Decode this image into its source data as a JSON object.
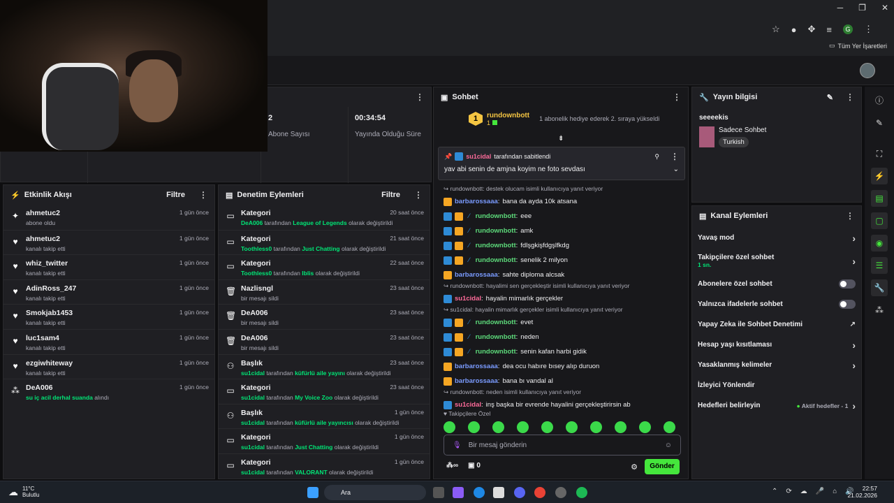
{
  "browser": {
    "bookmarks_label": "Tüm Yer İşaretleri",
    "profile_initial": "G"
  },
  "stats": [
    {
      "value": "2",
      "label": "Abone Sayısı"
    },
    {
      "value": "00:34:54",
      "label": "Yayında Olduğu Süre"
    }
  ],
  "feed": {
    "title": "Etkinlik Akışı",
    "filter": "Filtre",
    "items": [
      {
        "user": "ahmetuc2",
        "action": "abone oldu",
        "time": "1 gün önce",
        "icon": "sparkle"
      },
      {
        "user": "ahmetuc2",
        "action": "kanalı takip etti",
        "time": "1 gün önce",
        "icon": "heart"
      },
      {
        "user": "whiz_twitter",
        "action": "kanalı takip etti",
        "time": "1 gün önce",
        "icon": "heart"
      },
      {
        "user": "AdinRoss_247",
        "action": "kanalı takip etti",
        "time": "1 gün önce",
        "icon": "heart"
      },
      {
        "user": "Smokjab1453",
        "action": "kanalı takip etti",
        "time": "1 gün önce",
        "icon": "heart"
      },
      {
        "user": "luc1sam4",
        "action": "kanalı takip etti",
        "time": "1 gün önce",
        "icon": "heart"
      },
      {
        "user": "ezgiwhiteway",
        "action": "kanalı takip etti",
        "time": "1 gün önce",
        "icon": "heart"
      },
      {
        "user": "DeA006",
        "highlight": "su iç acil derhal suanda",
        "action": "alındı",
        "time": "1 gün önce",
        "icon": "points"
      }
    ]
  },
  "audit": {
    "title": "Denetim Eylemleri",
    "filter": "Filtre",
    "items": [
      {
        "title": "Kategori",
        "actor": "DeA006",
        "mid": "tarafından",
        "value": "League of Legends",
        "suffix": "olarak değiştirildi",
        "time": "20 saat önce"
      },
      {
        "title": "Kategori",
        "actor": "Toothless0",
        "mid": "tarafından",
        "value": "Just Chatting",
        "suffix": "olarak değiştirildi",
        "time": "21 saat önce"
      },
      {
        "title": "Kategori",
        "actor": "Toothless0",
        "mid": "tarafından",
        "value": "Iblis",
        "suffix": "olarak değiştirildi",
        "time": "22 saat önce"
      },
      {
        "title": "Nazlisngl",
        "actor": "",
        "mid": "",
        "value": "",
        "suffix": "bir mesajı sildi",
        "time": "23 saat önce"
      },
      {
        "title": "DeA006",
        "actor": "",
        "mid": "",
        "value": "",
        "suffix": "bir mesajı sildi",
        "time": "23 saat önce"
      },
      {
        "title": "DeA006",
        "actor": "",
        "mid": "",
        "value": "",
        "suffix": "bir mesajı sildi",
        "time": "23 saat önce"
      },
      {
        "title": "Başlık",
        "actor": "su1cidal",
        "mid": "tarafından",
        "value": "küfürlü aile yayını",
        "suffix": "olarak değiştirildi",
        "time": "23 saat önce"
      },
      {
        "title": "Kategori",
        "actor": "su1cidal",
        "mid": "tarafından",
        "value": "My Voice Zoo",
        "suffix": "olarak değiştirildi",
        "time": "23 saat önce"
      },
      {
        "title": "Başlık",
        "actor": "su1cidal",
        "mid": "tarafından",
        "value": "küfürlü aile yayıncısı",
        "suffix": "olarak değiştirildi",
        "time": "1 gün önce"
      },
      {
        "title": "Kategori",
        "actor": "su1cidal",
        "mid": "tarafından",
        "value": "Just Chatting",
        "suffix": "olarak değiştirildi",
        "time": "1 gün önce"
      },
      {
        "title": "Kategori",
        "actor": "su1cidal",
        "mid": "tarafından",
        "value": "VALORANT",
        "suffix": "olarak değiştirildi",
        "time": "1 gün önce"
      }
    ]
  },
  "chat": {
    "title": "Sohbet",
    "sub_user": "rundownbott",
    "sub_count": "1",
    "sub_text": "1 abonelik hediye ederek 2. sıraya yükseldi",
    "pinned_by": "su1cidal",
    "pinned_label": "tarafından sabitlendi",
    "pinned_text": "yav abi senin de amjna koyim ne foto sevdası",
    "messages": [
      {
        "reply": "rundownbott: destek olucam isimli kullanıcıya yanıt veriyor"
      },
      {
        "user": "barbarossaaa",
        "text": "bana da ayda 10k atsana",
        "style": "b",
        "badges": "g"
      },
      {
        "user": "rundownbott",
        "text": "eee",
        "style": "g",
        "badges": "bgs"
      },
      {
        "user": "rundownbott",
        "text": "amk",
        "style": "g",
        "badges": "bgs"
      },
      {
        "user": "rundownbott",
        "text": "fdlşgkişfdgşlfkdg",
        "style": "g",
        "badges": "bgs"
      },
      {
        "user": "rundownbott",
        "text": "senelik 2 milyon",
        "style": "g",
        "badges": "bgs"
      },
      {
        "user": "barbarossaaa",
        "text": "sahte diploma alcsak",
        "style": "b",
        "badges": "g"
      },
      {
        "reply": "rundownbott: hayalimi sen gerçekleştir isimli kullanıcıya yanıt veriyor"
      },
      {
        "user": "su1cidal",
        "text": "hayalin mimarlık gerçekler",
        "style": "p",
        "badges": "b"
      },
      {
        "reply": "su1cidal: hayalin mimarlık gerçekler isimli kullanıcıya yanıt veriyor"
      },
      {
        "user": "rundownbott",
        "text": "evet",
        "style": "g",
        "badges": "bgs"
      },
      {
        "user": "rundownbott",
        "text": "neden",
        "style": "g",
        "badges": "bgs"
      },
      {
        "user": "rundownbott",
        "text": "senin kafan harbi gidik",
        "style": "g",
        "badges": "bgs"
      },
      {
        "user": "barbarossaaa",
        "text": "dea ocu habıre bısey alıp duruon",
        "style": "b",
        "badges": "g"
      },
      {
        "user": "barbarossaaa",
        "text": "bana bı vandal al",
        "style": "b",
        "badges": "g"
      },
      {
        "reply": "rundownbott: neden isimli kullanıcıya yanıt veriyor"
      },
      {
        "user": "su1cidal",
        "text": "inş başka bir evrende hayalini gerçekleştirirsin ab",
        "style": "p",
        "badges": "b"
      }
    ],
    "followers_label": "Takipçilere Özel",
    "placeholder": "Bir mesaj gönderin",
    "points": "0",
    "send": "Gönder"
  },
  "info": {
    "title": "Yayın bilgisi",
    "stream_title": "seeeekis",
    "mode": "Sadece Sohbet",
    "tag": "Turkish"
  },
  "actions": {
    "title": "Kanal Eylemleri",
    "items": [
      {
        "label": "Yavaş mod",
        "type": "chev"
      },
      {
        "label": "Takipçilere özel sohbet",
        "sub": "1 sn.",
        "type": "chev"
      },
      {
        "label": "Abonelere özel sohbet",
        "type": "toggle"
      },
      {
        "label": "Yalnızca ifadelerle sohbet",
        "type": "toggle"
      },
      {
        "label": "Yapay Zeka ile Sohbet Denetimi",
        "type": "ext"
      },
      {
        "label": "Hesap yaşı kısıtlaması",
        "type": "chev"
      },
      {
        "label": "Yasaklanmış kelimeler",
        "type": "chev"
      },
      {
        "label": "İzleyici Yönlendir",
        "type": "none"
      },
      {
        "label": "Hedefleri belirleyin",
        "extra": "Aktif hedefler - 1",
        "type": "chev"
      }
    ]
  },
  "taskbar": {
    "weather_temp": "11°C",
    "weather_desc": "Bulutlu",
    "search": "Ara",
    "time": "22:57",
    "date": "21.02.2026"
  }
}
